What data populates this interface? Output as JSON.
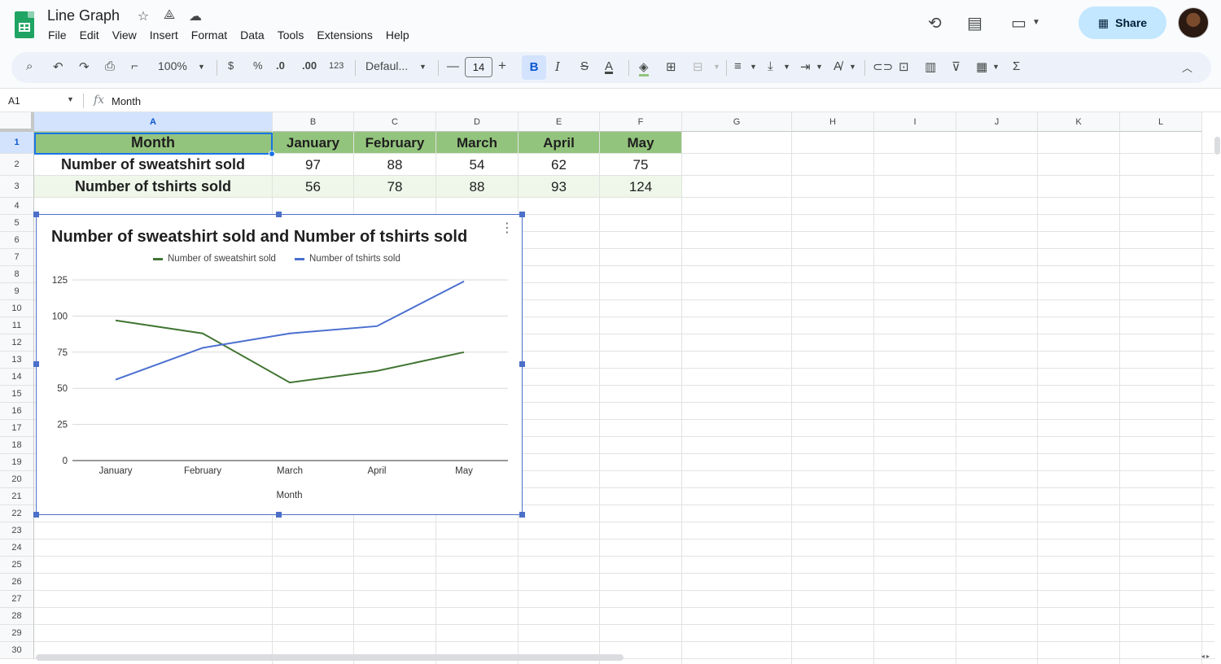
{
  "header": {
    "title": "Line Graph",
    "menu": [
      "File",
      "Edit",
      "View",
      "Insert",
      "Format",
      "Data",
      "Tools",
      "Extensions",
      "Help"
    ],
    "share_label": "Share"
  },
  "toolbar": {
    "zoom": "100%",
    "currency": "$",
    "percent": "%",
    "decrease_decimal": ".0",
    "increase_decimal": ".00",
    "number_format": "123",
    "font": "Defaul...",
    "font_size": "14",
    "bold": "B",
    "italic": "I",
    "strike": "S",
    "text_color": "A",
    "sum": "Σ"
  },
  "formula_bar": {
    "cell_ref": "A1",
    "fx": "fx",
    "value": "Month"
  },
  "grid": {
    "columns": [
      "A",
      "B",
      "C",
      "D",
      "E",
      "F",
      "G",
      "H",
      "I",
      "J",
      "K",
      "L"
    ],
    "rows": [
      "1",
      "2",
      "3",
      "4",
      "5",
      "6",
      "7",
      "8",
      "9",
      "10",
      "11",
      "12",
      "13",
      "14",
      "15",
      "16",
      "17",
      "18",
      "19",
      "20",
      "21",
      "22",
      "23",
      "24",
      "25",
      "26",
      "27",
      "28",
      "29",
      "30"
    ],
    "cells": [
      [
        "Month",
        "January",
        "February",
        "March",
        "April",
        "May"
      ],
      [
        "Number of sweatshirt sold",
        "97",
        "88",
        "54",
        "62",
        "75"
      ],
      [
        "Number of tshirts sold",
        "56",
        "78",
        "88",
        "93",
        "124"
      ]
    ],
    "header_row_color": "#93c47d",
    "band_row_color": "#eef7e9"
  },
  "chart_data": {
    "type": "line",
    "title": "Number of sweatshirt sold and Number of tshirts sold",
    "xlabel": "Month",
    "ylabel": "",
    "categories": [
      "January",
      "February",
      "March",
      "April",
      "May"
    ],
    "series": [
      {
        "name": "Number of sweatshirt sold",
        "values": [
          97,
          88,
          54,
          62,
          75
        ],
        "color": "#417533"
      },
      {
        "name": "Number of tshirts sold",
        "values": [
          56,
          78,
          88,
          93,
          124
        ],
        "color": "#4a6fd0"
      }
    ],
    "ylim": [
      0,
      125
    ],
    "yticks": [
      0,
      25,
      50,
      75,
      100,
      125
    ],
    "grid": true,
    "legend": "top"
  }
}
